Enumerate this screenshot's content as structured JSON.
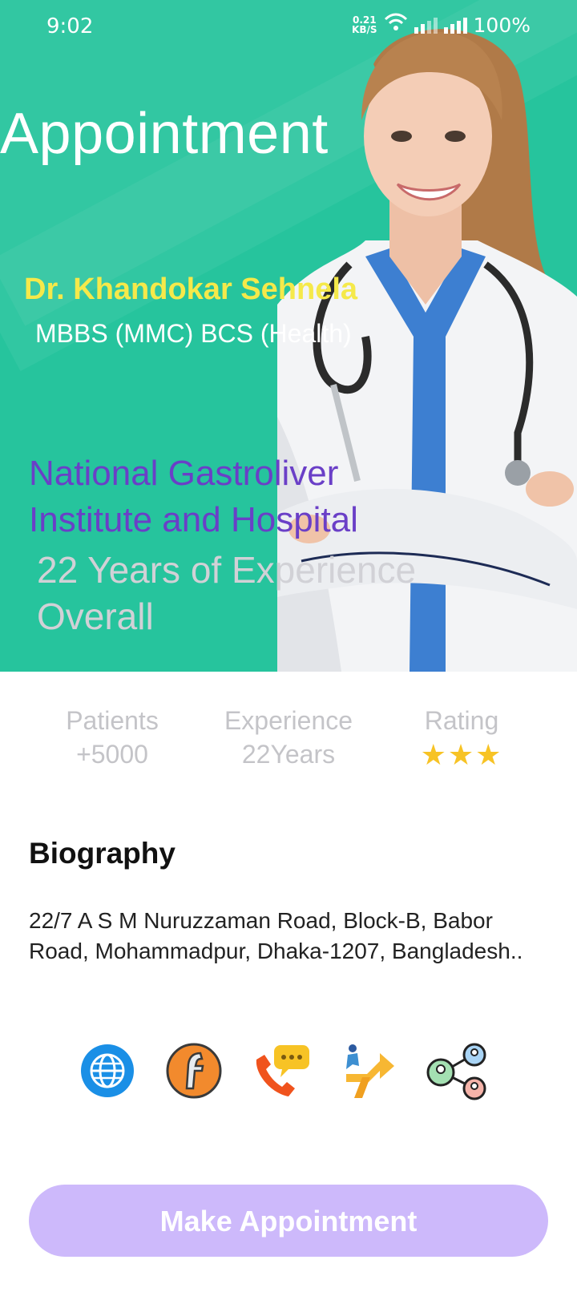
{
  "status_bar": {
    "time": "9:02",
    "net_speed_value": "0.21",
    "net_speed_unit": "KB/S",
    "battery": "100%"
  },
  "header": {
    "title": "Appointment"
  },
  "doctor": {
    "name": "Dr. Khandokar Sehnela",
    "degree": "MBBS (MMC) BCS (Health)",
    "hospital": "National Gastroliver Institute and Hospital",
    "experience_text": "22 Years of Experience Overall"
  },
  "stats": {
    "patients_label": "Patients",
    "patients_value": "+5000",
    "experience_label": "Experience",
    "experience_value": "22Years",
    "rating_label": "Rating",
    "rating_value": "★★★",
    "rating_stars": 3
  },
  "biography": {
    "title": "Biography",
    "text": "22/7 A S M Nuruzzaman Road, Block-B, Babor Road, Mohammadpur, Dhaka-1207, Bangladesh.."
  },
  "contact_icons": [
    "globe-icon",
    "firefox-f-icon",
    "call-chat-icon",
    "directions-icon",
    "share-network-icon"
  ],
  "actions": {
    "make_appointment": "Make Appointment"
  },
  "colors": {
    "hero_bg": "#26c49d",
    "name_color": "#f5e94a",
    "hospital_color": "#6a3fc7",
    "button_bg": "#cdb9fb"
  }
}
